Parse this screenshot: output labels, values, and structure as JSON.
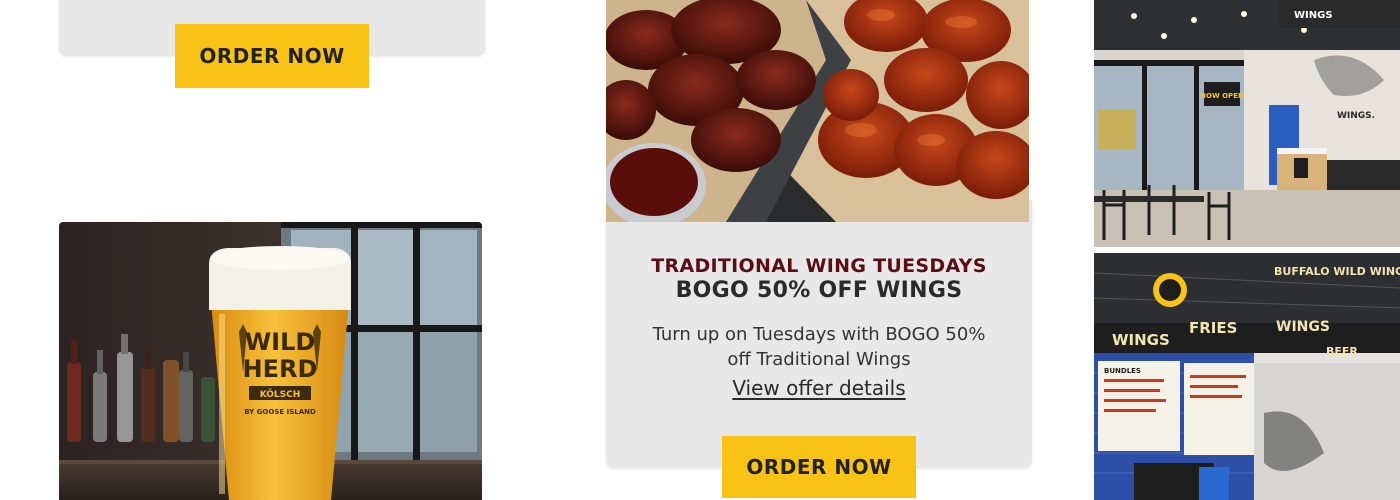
{
  "cards": {
    "top_left": {
      "button_label": "ORDER NOW"
    },
    "promo": {
      "kicker": "TRADITIONAL WING TUESDAYS",
      "title": "BOGO 50% OFF WINGS",
      "description": "Turn up on Tuesdays with BOGO 50% off Traditional Wings",
      "link_label": "View offer details",
      "button_label": "ORDER NOW"
    }
  },
  "images": {
    "beer_glass_text": {
      "line1": "WILD",
      "line2": "HERD",
      "band": "KÖLSCH",
      "tagline": "BY GOOSE ISLAND"
    },
    "store_exterior_signs": {
      "window_sign": "NOW OPEN",
      "counter_sign": "WINGS.",
      "ceiling_sign": "WINGS"
    },
    "store_interior_signs": {
      "sign_wings": "WINGS",
      "sign_fries": "FRIES",
      "sign_wings2": "WINGS",
      "sign_bar": "BEER",
      "sign_bww": "BUFFALO WILD WINGS",
      "menu_header": "BUNDLES"
    }
  },
  "colors": {
    "button_yellow": "#f9c315",
    "kicker_maroon": "#5a0d12",
    "card_gray": "#e8e8e8"
  }
}
